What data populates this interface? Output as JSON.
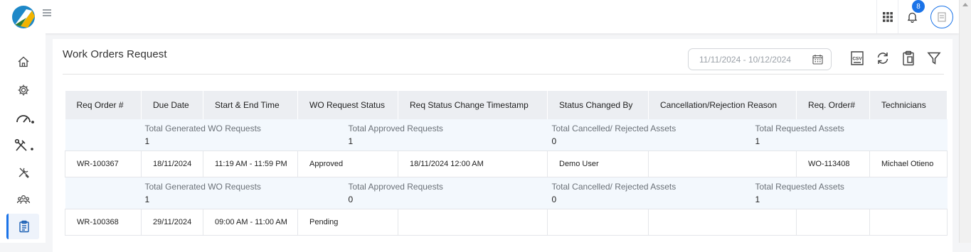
{
  "header": {
    "notification_count": "8"
  },
  "page": {
    "title": "Work Orders Request",
    "date_range": "11/11/2024 - 10/12/2024",
    "csv_label": "CSV"
  },
  "table": {
    "columns": [
      "Req Order #",
      "Due Date",
      "Start & End Time",
      "WO Request Status",
      "Req Status Change Timestamp",
      "Status Changed By",
      "Cancellation/Rejection Reason",
      "Req. Order#",
      "Technicians"
    ],
    "summary_labels": [
      "Total Generated WO Requests",
      "Total Approved Requests",
      "Total Cancelled/ Rejected Assets",
      "Total Requested Assets"
    ],
    "groups": [
      {
        "summary_values": [
          "1",
          "1",
          "0",
          "1"
        ],
        "row": [
          "WR-100367",
          "18/11/2024",
          "11:19 AM - 11:59 PM",
          "Approved",
          "18/11/2024 12:00 AM",
          "Demo User",
          "",
          "WO-113408",
          "Michael Otieno"
        ]
      },
      {
        "summary_values": [
          "1",
          "0",
          "0",
          "1"
        ],
        "row": [
          "WR-100368",
          "29/11/2024",
          "09:00 AM - 11:00 AM",
          "Pending",
          "",
          "",
          "",
          "",
          ""
        ]
      }
    ]
  },
  "icons": {
    "sidebar": [
      "home-icon",
      "settings-icon",
      "gauge-icon",
      "tools-icon",
      "maintenance-icon",
      "team-icon",
      "clipboard-icon"
    ],
    "toolbar": [
      "csv-icon",
      "refresh-icon",
      "clipboard-icon",
      "filter-icon"
    ]
  },
  "colors": {
    "accent": "#1a73e8",
    "header_bg": "#eceef2",
    "summary_bg": "#f3f8fd"
  }
}
